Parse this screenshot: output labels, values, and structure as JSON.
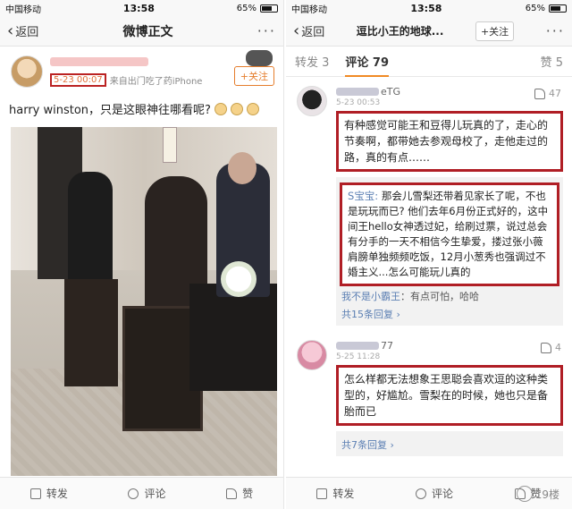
{
  "status": {
    "carrier": "中国移动",
    "time": "13:58",
    "battery": "65%"
  },
  "left": {
    "nav": {
      "back_label": "返回",
      "title": "微博正文",
      "more": "···"
    },
    "post": {
      "timestamp": "5-23 00:07",
      "source": "来自出门吃了药iPhone",
      "follow_label": "+关注",
      "text": "harry winston，只是这眼神往哪看呢?"
    },
    "actions": {
      "repost": "转发",
      "comment": "评论",
      "like": "赞"
    }
  },
  "right": {
    "nav": {
      "back_label": "返回",
      "title": "逗比小王的地球...",
      "follow_label": "+关注",
      "more": "···"
    },
    "tabs": {
      "repost": "转发 3",
      "comment": "评论 79",
      "like": "赞 5"
    },
    "comments": [
      {
        "name_suffix": "eTG",
        "time": "5-23 00:53",
        "likes": "47",
        "text": "有种感觉可能王和豆得儿玩真的了，走心的节奏啊，都带她去参观母校了，走他走过的路，真的有点……",
        "replies": [
          {
            "user": "S",
            "user_tail": "宝宝:",
            "text": "那会儿雪梨还带着见家长了呢，不也是玩玩而已? 他们去年6月份正式好的，这中间王hello女神透过妃，给刷过票，说过总会有分手的一天不相信今生挚爱，搂过张小薇肩膀单独频频吃饭，12月小葱秀也强调过不婚主义...怎么可能玩儿真的"
          },
          {
            "user": "我不是小霸王",
            "text": "：有点可怕，哈哈"
          }
        ],
        "more_replies": "共15条回复 ›"
      },
      {
        "name_suffix": "77",
        "time": "5-25 11:28",
        "likes": "4",
        "text": "怎么样都无法想象王思聪会喜欢逗的这种类型的，好尴尬。雪梨在的时候，她也只是备胎而已",
        "more_replies": "共7条回复 ›"
      }
    ],
    "actions": {
      "repost": "转发",
      "comment": "评论",
      "like": "赞"
    },
    "watermark": "19楼"
  }
}
